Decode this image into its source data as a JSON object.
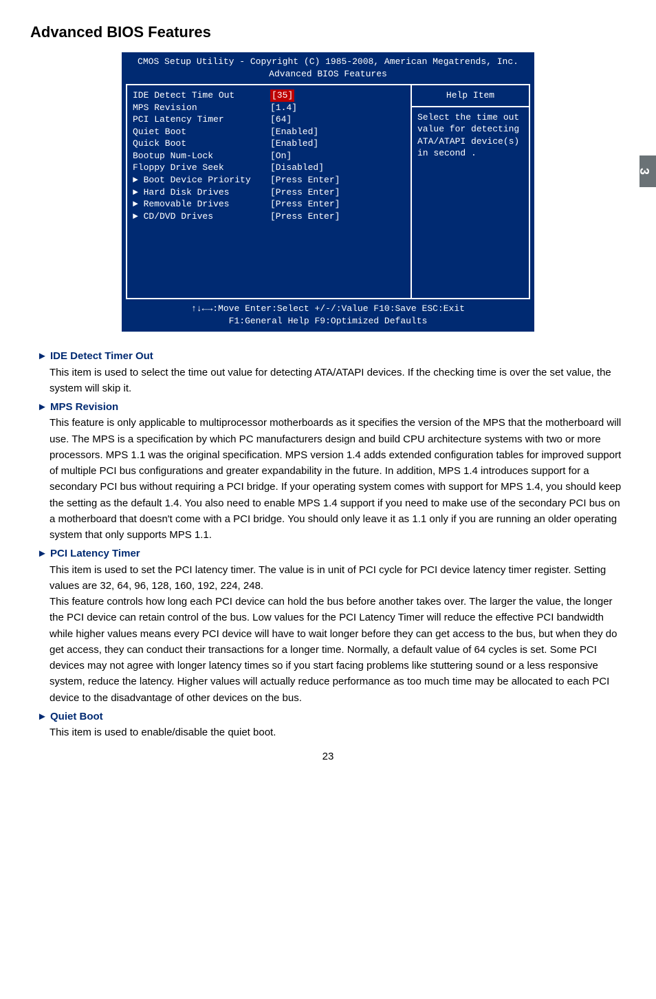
{
  "title": "Advanced BIOS Features",
  "side_tab": "3",
  "bios": {
    "header_line1": "CMOS Setup Utility - Copyright (C) 1985-2008, American Megatrends, Inc.",
    "header_line2": "Advanced BIOS Features",
    "rows": [
      {
        "label": "IDE Detect Time Out",
        "value": "[35]",
        "value_hl": true
      },
      {
        "label": "MPS Revision",
        "value": "[1.4]"
      },
      {
        "label": "PCI Latency Timer",
        "value": "[64]"
      },
      {
        "label": "Quiet Boot",
        "value": "[Enabled]"
      },
      {
        "label": "Quick Boot",
        "value": "[Enabled]"
      },
      {
        "label": "Bootup Num-Lock",
        "value": "[On]"
      },
      {
        "label": "Floppy Drive Seek",
        "value": "[Disabled]"
      },
      {
        "label": "► Boot Device Priority",
        "value": "[Press Enter]",
        "yellow": true
      },
      {
        "label": "► Hard Disk Drives",
        "value": "[Press Enter]",
        "yellow": true
      },
      {
        "label": "► Removable Drives",
        "value": "[Press Enter]",
        "yellow": true
      },
      {
        "label": "► CD/DVD Drives",
        "value": "[Press Enter]",
        "yellow": true
      }
    ],
    "help_title": "Help Item",
    "help_body": "Select the time out value for detecting ATA/ATAPI device(s) in second .",
    "footer_line1": "↑↓←→:Move   Enter:Select     +/-/:Value     F10:Save      ESC:Exit",
    "footer_line2": "F1:General Help                       F9:Optimized Defaults"
  },
  "sections": {
    "s1_head": "► IDE Detect Timer Out",
    "s1_body": "This item is used to select the time out value for detecting ATA/ATAPI devices. If the checking time is over the set value, the system will skip it.",
    "s2_head": "► MPS Revision",
    "s2_body": "This feature is only applicable to multiprocessor motherboards as it specifies the version of the MPS that the motherboard will use. The MPS is a specification by which PC manufacturers design and build CPU architecture systems with two or more processors. MPS 1.1 was the original specification. MPS version 1.4 adds extended configuration tables for improved support of multiple PCI bus configurations and greater expandability in the future. In addition, MPS 1.4 introduces support for a secondary PCI bus without requiring a PCI bridge. If your operating system comes with support for MPS 1.4, you should keep the setting as the default 1.4. You also need to enable MPS 1.4 support if you need to make use of the secondary PCI bus on a motherboard that doesn't come with a PCI bridge. You should only leave it as 1.1 only if you are running an older operating system that only supports MPS 1.1.",
    "s3_head": "► PCI Latency Timer",
    "s3_body": "This item is used to set the PCI latency timer. The value is in unit of PCI cycle for PCI device latency timer register. Setting values are 32, 64, 96, 128, 160, 192, 224, 248.\nThis feature controls how long each PCI device can hold the bus before another takes over. The larger the value, the longer the PCI device can retain control of the bus. Low values for the PCI Latency Timer will reduce the effective PCI bandwidth while higher values means every PCI device will have to wait longer before they can get access to the bus, but when they do get access, they can conduct their transactions for a longer time. Normally, a default value of 64 cycles is set. Some PCI devices may not agree with longer latency times so if you start facing problems like stuttering sound or a less responsive system, reduce the latency. Higher values will actually reduce performance as too much time may be allocated to each PCI device to the disadvantage of other devices on the bus.",
    "s4_head": "► Quiet Boot",
    "s4_body": "This item is used to enable/disable the quiet boot."
  },
  "page_number": "23"
}
